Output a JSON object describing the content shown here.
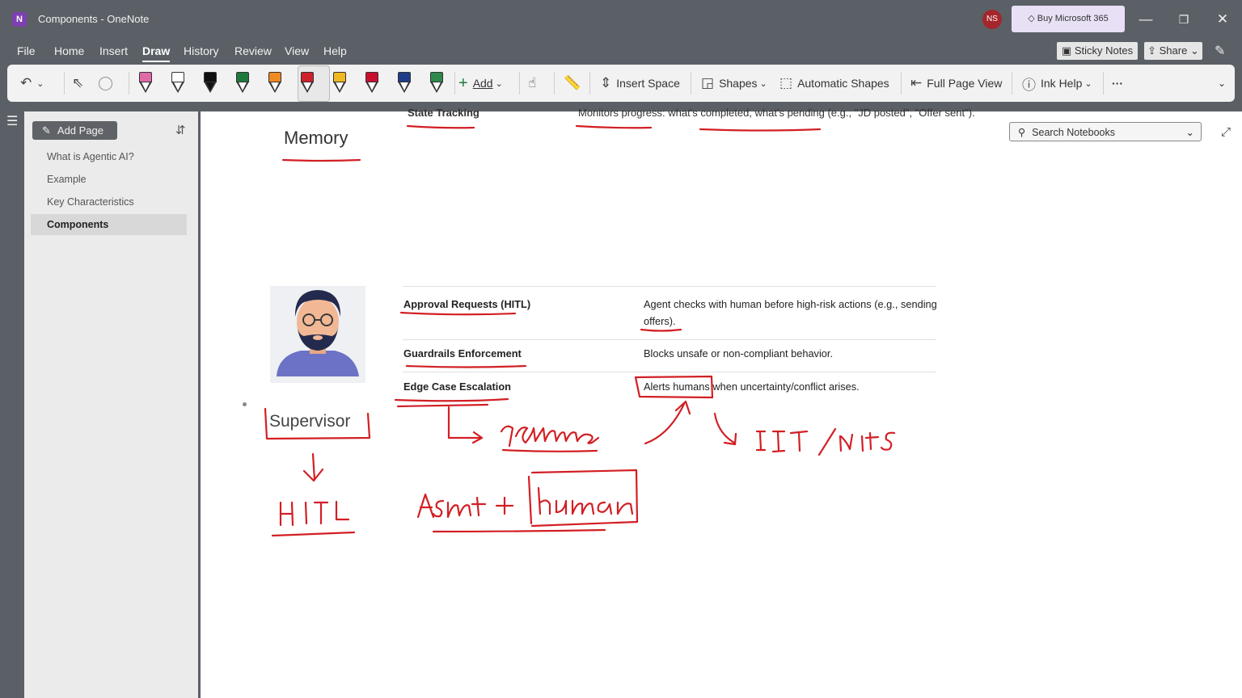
{
  "window": {
    "app_initial": "N",
    "title": "Components  -  OneNote",
    "user_initials": "NS",
    "buy_label": "Buy Microsoft 365",
    "minimize": "—",
    "restore": "❐",
    "close": "✕"
  },
  "menu": {
    "tabs": [
      "File",
      "Home",
      "Insert",
      "Draw",
      "History",
      "Review",
      "View",
      "Help"
    ],
    "active_tab": "Draw",
    "sticky_notes": "Sticky Notes",
    "share": "Share"
  },
  "ribbon": {
    "add": "Add",
    "insert_space": "Insert Space",
    "shapes": "Shapes",
    "automatic_shapes": "Automatic Shapes",
    "full_page_view": "Full Page View",
    "ink_help": "Ink Help",
    "more": "···",
    "pen_colors": [
      "#e06aa6",
      "#ffffff",
      "#111111",
      "#1e7a3c",
      "#f08a24",
      "#d0202a",
      "#f0b820",
      "#c8102e",
      "#1f3c88",
      "#2d8a4a"
    ]
  },
  "sidebar": {
    "add_page": "Add Page",
    "pages": [
      {
        "label": "What is Agentic AI?"
      },
      {
        "label": "Example"
      },
      {
        "label": "Key Characteristics"
      },
      {
        "label": "Components",
        "active": true
      }
    ]
  },
  "canvas": {
    "search_placeholder": "Search Notebooks",
    "top_row_left": "State Tracking",
    "top_row_right": "Monitors progress: what's completed, what's pending (e.g., \"JD posted\", \"Offer sent\").",
    "memory_heading": "Memory",
    "table": [
      {
        "name": "Approval Requests (HITL)",
        "desc_line1": "Agent checks with human before high-risk actions (e.g., sending",
        "desc_line2": "offers)."
      },
      {
        "name": "Guardrails Enforcement",
        "desc_line1": "Blocks unsafe or non-compliant behavior.",
        "desc_line2": ""
      },
      {
        "name": "Edge Case Escalation",
        "desc_line1": "Alerts humans when uncertainty/conflict arises.",
        "desc_line2": ""
      }
    ],
    "supervisor_label": "Supervisor",
    "ink_color": "#d21f24"
  }
}
